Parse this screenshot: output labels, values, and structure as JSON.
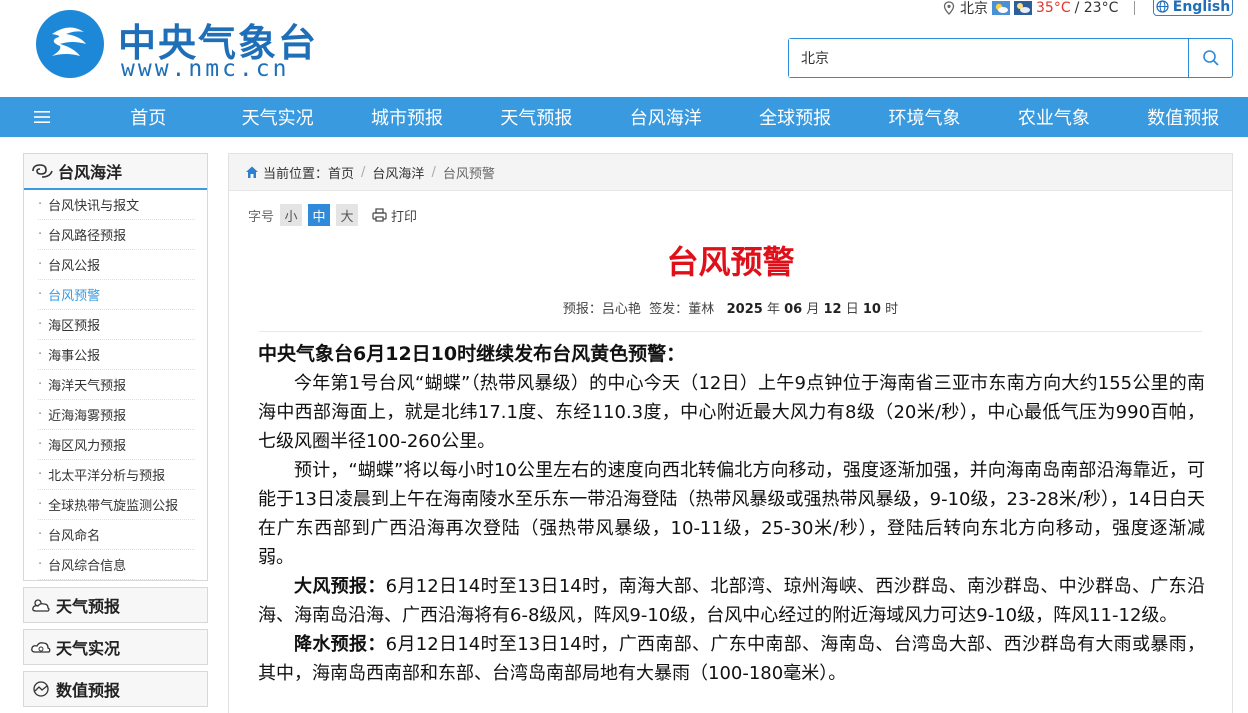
{
  "header": {
    "logo_title": "中央气象台",
    "logo_url": "www.nmc.cn",
    "city": "北京",
    "temp_high": "35°C",
    "temp_low": "/ 23°C",
    "english_label": "English",
    "search_value": "北京"
  },
  "nav": {
    "items": [
      "首页",
      "天气实况",
      "城市预报",
      "天气预报",
      "台风海洋",
      "全球预报",
      "环境气象",
      "农业气象",
      "数值预报"
    ]
  },
  "sidebar": {
    "section_title": "台风海洋",
    "items": [
      "台风快讯与报文",
      "台风路径预报",
      "台风公报",
      "台风预警",
      "海区预报",
      "海事公报",
      "海洋天气预报",
      "近海海雾预报",
      "海区风力预报",
      "北太平洋分析与预报",
      "全球热带气旋监测公报",
      "台风命名",
      "台风综合信息"
    ],
    "active_index": 3,
    "categories": [
      "天气预报",
      "天气实况",
      "数值预报"
    ]
  },
  "breadcrumb": {
    "prefix": "当前位置：",
    "home": "首页",
    "section": "台风海洋",
    "current": "台风预警"
  },
  "toolbar": {
    "font_label": "字号",
    "small": "小",
    "medium": "中",
    "large": "大",
    "print": "打印"
  },
  "article": {
    "title": "台风预警",
    "meta_forecaster_label": "预报：",
    "meta_forecaster": "吕心艳",
    "meta_issuer_label": "签发：",
    "meta_issuer": "董林",
    "meta_year": "2025",
    "meta_month": "06",
    "meta_day": "12",
    "meta_hour": "10",
    "meta_u_year": "年",
    "meta_u_month": "月",
    "meta_u_day": "日",
    "meta_u_hour": "时",
    "headline": "中央气象台6月12日10时继续发布台风黄色预警：",
    "para1": "今年第1号台风“蝴蝶”（热带风暴级）的中心今天（12日）上午9点钟位于海南省三亚市东南方向大约155公里的南海中西部海面上，就是北纬17.1度、东经110.3度，中心附近最大风力有8级（20米/秒），中心最低气压为990百帕，七级风圈半径100-260公里。",
    "para2": "预计，“蝴蝶”将以每小时10公里左右的速度向西北转偏北方向移动，强度逐渐加强，并向海南岛南部沿海靠近，可能于13日凌晨到上午在海南陵水至乐东一带沿海登陆（热带风暴级或强热带风暴级，9-10级，23-28米/秒），14日白天在广东西部到广西沿海再次登陆（强热带风暴级，10-11级，25-30米/秒），登陆后转向东北方向移动，强度逐渐减弱。",
    "wind_label": "大风预报：",
    "wind_text": "6月12日14时至13日14时，南海大部、北部湾、琼州海峡、西沙群岛、南沙群岛、中沙群岛、广东沿海、海南岛沿海、广西沿海将有6-8级风，阵风9-10级，台风中心经过的附近海域风力可达9-10级，阵风11-12级。",
    "rain_label": "降水预报：",
    "rain_text": "6月12日14时至13日14时，广西南部、广东中南部、海南岛、台湾岛大部、西沙群岛有大雨或暴雨，其中，海南岛西南部和东部、台湾岛南部局地有大暴雨（100-180毫米）。"
  },
  "colors": {
    "nav_bg": "#3a9ae0",
    "brand": "#1f6fb8",
    "title_red": "#e0101a",
    "temp_high": "#e0362d"
  }
}
